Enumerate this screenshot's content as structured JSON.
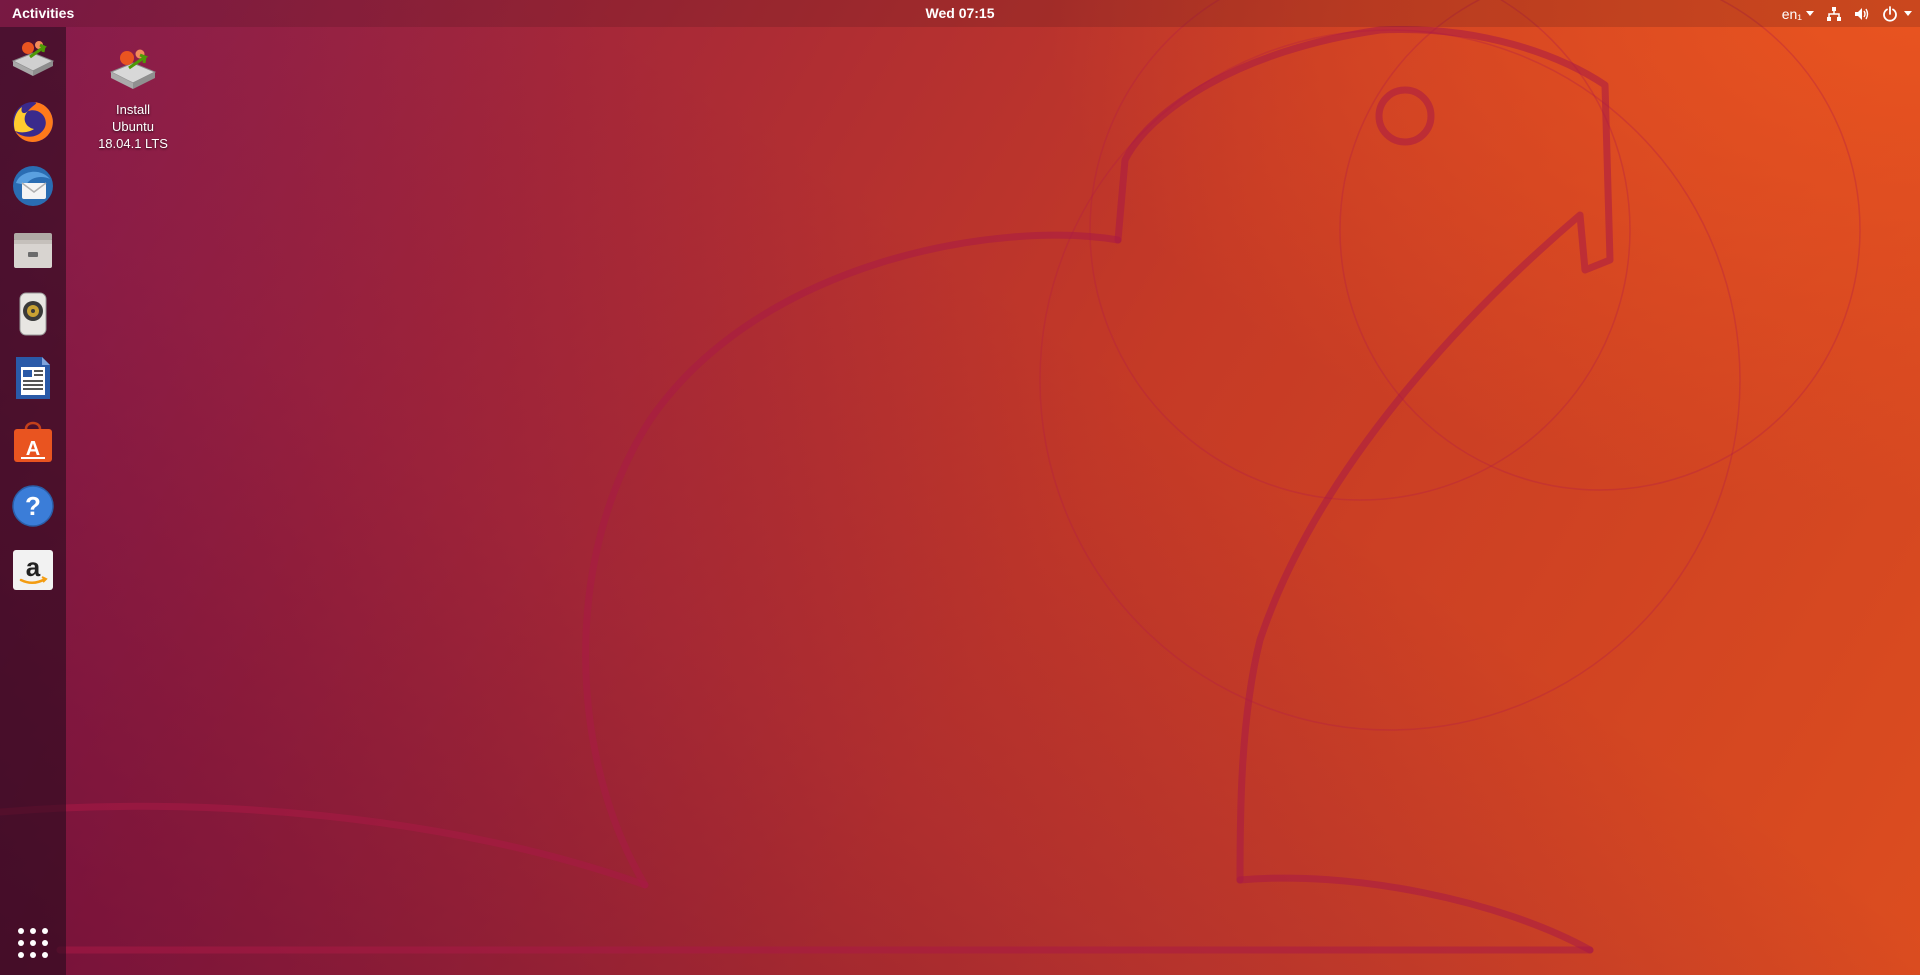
{
  "topbar": {
    "activities_label": "Activities",
    "clock": "Wed 07:15",
    "language": "en₁"
  },
  "tray_icons": [
    "network-icon",
    "volume-icon",
    "power-icon"
  ],
  "dock": {
    "items": [
      {
        "name": "installer-icon"
      },
      {
        "name": "firefox-icon"
      },
      {
        "name": "thunderbird-icon"
      },
      {
        "name": "files-icon"
      },
      {
        "name": "rhythmbox-icon"
      },
      {
        "name": "writer-icon"
      },
      {
        "name": "software-center-icon"
      },
      {
        "name": "help-icon"
      },
      {
        "name": "amazon-icon"
      },
      {
        "name": "show-applications-icon"
      }
    ]
  },
  "desktop": {
    "icons": [
      {
        "label_line1": "Install",
        "label_line2": "Ubuntu",
        "label_line3": "18.04.1 LTS"
      }
    ]
  },
  "colors": {
    "accent_orange": "#e95420",
    "aubergine": "#77216f"
  }
}
